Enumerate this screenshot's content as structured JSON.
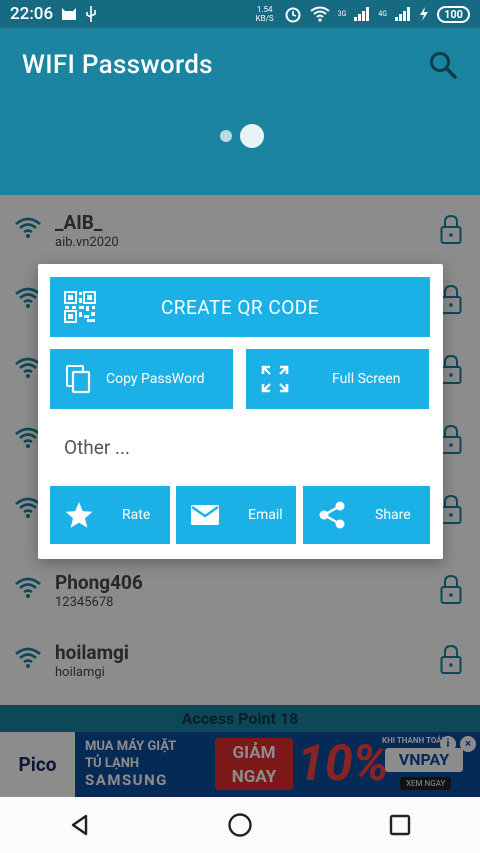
{
  "status_bar": {
    "time": "22:06",
    "net_speed": "1.54 KB/S",
    "net_type_1": "3G",
    "net_type_2": "4G",
    "battery": "100"
  },
  "app_bar": {
    "title": "WIFI Passwords"
  },
  "wifi_list": [
    {
      "ssid": "_AIB_",
      "password": "aib.vn2020"
    },
    {
      "ssid": "",
      "password": ""
    },
    {
      "ssid": "",
      "password": ""
    },
    {
      "ssid": "",
      "password": ""
    },
    {
      "ssid": "",
      "password": ""
    },
    {
      "ssid": "Phong406",
      "password": "12345678"
    },
    {
      "ssid": "hoilamgi",
      "password": "hoilamgi"
    }
  ],
  "bottom_label": "Access Point 18",
  "dialog": {
    "create_qr": "CREATE QR CODE",
    "copy_password": "Copy PassWord",
    "full_screen": "Full Screen",
    "other": "Other ...",
    "rate": "Rate",
    "email": "Email",
    "share": "Share"
  },
  "ad": {
    "brand": "Pico",
    "line1": "MUA MÁY GIẶT",
    "line2": "TỦ LẠNH",
    "line3": "SAMSUNG",
    "promo": "GIẢM NGAY",
    "discount": "10%",
    "pay_note": "KHI THANH TOÁN",
    "pay_brand": "VNPAY",
    "cta": "XEM NGAY"
  },
  "colors": {
    "appbar": "#1b84a1",
    "button": "#1bb1e6"
  }
}
